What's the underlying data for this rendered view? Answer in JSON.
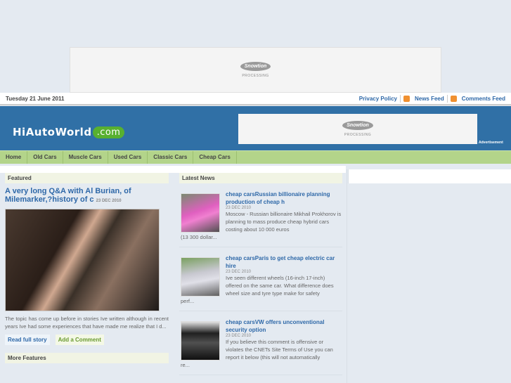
{
  "ads": {
    "brand": "Snowtion",
    "sub": "PROCESSING",
    "label": "Advertisement"
  },
  "topbar": {
    "date": "Tuesday 21 June 2011",
    "privacy": "Privacy Policy",
    "news_feed": "News Feed",
    "comments_feed": "Comments Feed"
  },
  "site": {
    "name": "HiAutoWorld",
    "tld": ".com"
  },
  "nav": [
    "Home",
    "Old Cars",
    "Muscle Cars",
    "Used Cars",
    "Classic Cars",
    "Cheap Cars"
  ],
  "featured": {
    "heading": "Featured",
    "title": "A very long Q&A with Al Burian, of Milemarker,?history of c",
    "date": "23 DEC 2010",
    "text": "The topic has come up before in stories Ive written although in recent years Ive had some experiences that have made me realize that I d...",
    "read": "Read full story",
    "comment": "Add a Comment",
    "more": "More Features"
  },
  "latest": {
    "heading": "Latest News",
    "items": [
      {
        "title": "cheap carsRussian billionaire planning production of cheap h",
        "date": "23 DEC 2010",
        "text": "Moscow - Russian billionaire Mikhail Prokhorov is planning to mass produce cheap hybrid cars costing about 10 000 euros",
        "cont": "(13 300 dollar..."
      },
      {
        "title": "cheap carsParis to get cheap electric car hire",
        "date": "23 DEC 2010",
        "text": "Ive seen different wheels (16-inch  17-inch) offered on the same car. What difference does wheel size and tyre type make for safety",
        "cont": "perf..."
      },
      {
        "title": "cheap carsVW offers unconventional security option",
        "date": "23 DEC 2010",
        "text": "If you believe this comment is offensive or violates the CNETs Site Terms of Use  you can report it below (this will not automatically",
        "cont": "re..."
      }
    ]
  }
}
